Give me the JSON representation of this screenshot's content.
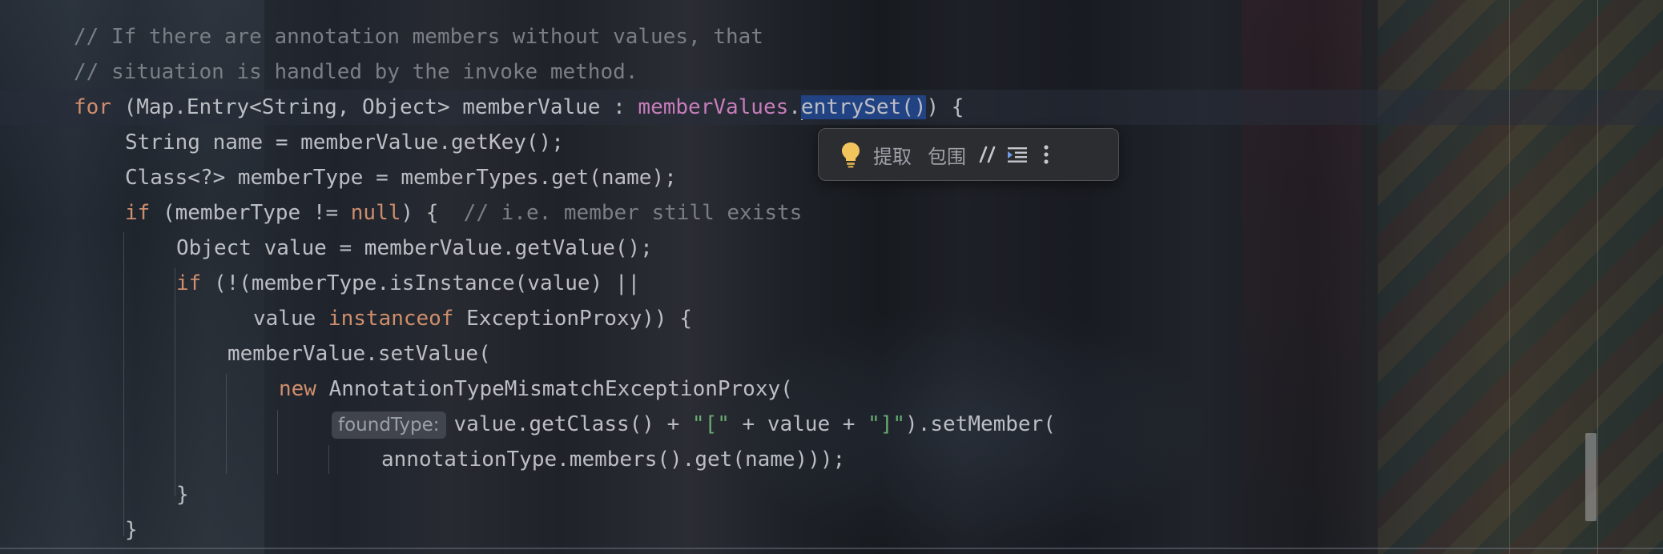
{
  "editor": {
    "lines": [
      {
        "id": "comment1",
        "text": "// If there are annotation members without values, that"
      },
      {
        "id": "comment2",
        "text": "// situation is handled by the invoke method."
      },
      {
        "id": "for_line",
        "kw_for": "for",
        "pre": " (Map.Entry<String, Object> memberValue : ",
        "field": "memberValues",
        "dot": ".",
        "selected": "entrySet()",
        "post": ") {"
      },
      {
        "id": "line_name",
        "text": "String name = memberValue.getKey();"
      },
      {
        "id": "line_membertype",
        "text": "Class<?> memberType = memberTypes.get(name);"
      },
      {
        "id": "line_if1",
        "kw_if": "if",
        "pre": " (memberType != ",
        "kw_null": "null",
        "post": ") {  ",
        "comment": "// i.e. member still exists"
      },
      {
        "id": "line_value",
        "text": "Object value = memberValue.getValue();"
      },
      {
        "id": "line_if2",
        "kw_if": "if",
        "post": " (!(memberType.isInstance(value) ||"
      },
      {
        "id": "line_instanceof",
        "pre": "value ",
        "kw_instanceof": "instanceof",
        "post": " ExceptionProxy)) {"
      },
      {
        "id": "line_setvalue",
        "text": "memberValue.setValue("
      },
      {
        "id": "line_new",
        "kw_new": "new",
        "post": " AnnotationTypeMismatchExceptionProxy("
      },
      {
        "id": "line_getclass",
        "hint": "foundType:",
        "pre": "value.getClass() + ",
        "str1": "\"[\"",
        "mid": " + value + ",
        "str2": "\"]\"",
        "post": ").setMember("
      },
      {
        "id": "line_members",
        "text": "annotationType.members().get(name)));"
      },
      {
        "id": "line_close1",
        "text": "}"
      },
      {
        "id": "line_close2",
        "text": "}"
      }
    ]
  },
  "toolbar": {
    "icons": [
      "lightbulb-icon",
      "comment-icon",
      "reformat-icon",
      "more-vertical-icon"
    ],
    "extract_label": "提取",
    "surround_label": "包围"
  },
  "colors": {
    "keyword": "#cf8e6d",
    "comment": "#7a7e85",
    "field": "#c77dbb",
    "string": "#6aab73",
    "default_text": "#bcbec4",
    "selection": "#214283",
    "bulb": "#f2c55c"
  }
}
